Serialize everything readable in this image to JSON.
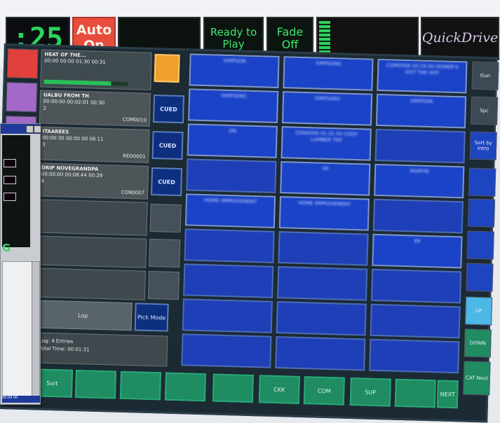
{
  "topbar": {
    "clock": ":25",
    "auto": "Auto On",
    "scheduled": "",
    "ready": "Ready to Play",
    "fade": "Fade Off",
    "logo": "QuickDrive",
    "colors": {
      "clock": "#29d45f",
      "auto_bg": "#e74c3c",
      "status_text": "#3ce86c"
    }
  },
  "side_buttons": [
    {
      "label": "",
      "color": "#e2403c"
    },
    {
      "label": "",
      "color": "#a368c8"
    },
    {
      "label": "",
      "color": "#a368c8"
    }
  ],
  "log": {
    "rows": [
      {
        "title": "HEAT OF THE...",
        "times": "00:00 00:00 01:30 00:31",
        "extra": "",
        "code": "",
        "playing": true
      },
      {
        "title": "UALBU FROM TH",
        "times": "00:00:00 00:02:01 00:30",
        "extra": "2",
        "code": "COM0010",
        "playing": false
      },
      {
        "title": "ITAAREES",
        "times": "00:00:30 00:00 00 06 11",
        "extra": "3",
        "code": "RED0001",
        "playing": false
      },
      {
        "title": "DRIP NOVEGRANDPA",
        "times": "00:00:00 00:08:44 00:29",
        "extra": "4",
        "code": "CON0007",
        "playing": false
      }
    ],
    "cued_label": "CUED",
    "footer_button": "Lop",
    "pick_mode": "Pick Mode",
    "summary_line1": "Log: 4 Entries",
    "summary_line2": "Total Time: 00:01:31"
  },
  "carts": [
    [
      "SIMPSON",
      "SIMPSONS",
      "COM0008 00:29 00 HOMER'S GOT THE HOT"
    ],
    [
      "SIMPSONS",
      "SIMPSONS",
      "SIMPSON"
    ],
    [
      "ON",
      "CON0000 01:31 00 CODY LAMBER TEP",
      ""
    ],
    [
      "",
      "AR",
      "MARTIN"
    ],
    [
      "HOME IMPROVEMENT",
      "HOME IMPROVEMENT",
      ""
    ],
    [
      "",
      "",
      "ER"
    ],
    [
      "",
      "",
      ""
    ],
    [
      "",
      "",
      ""
    ],
    [
      "",
      "",
      ""
    ]
  ],
  "right_buttons": [
    "Gun",
    "Spc",
    "Sort by Intro",
    "",
    "",
    "",
    "",
    "UP",
    "DOWN",
    "CAT Next"
  ],
  "bottom_buttons": [
    "Sort",
    "",
    "",
    "",
    "",
    "CKK",
    "COM",
    "SUP",
    "",
    "NEXT"
  ],
  "overlay": {
    "status": "00:00 00"
  }
}
